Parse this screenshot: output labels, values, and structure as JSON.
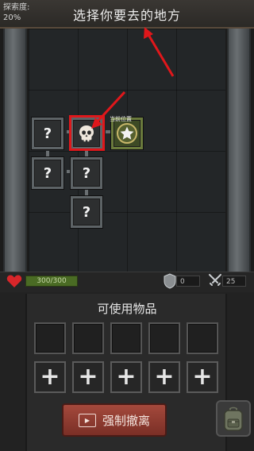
{
  "header": {
    "explore_label": "探索度:",
    "explore_value": "20%",
    "title": "选择你要去的地方"
  },
  "map": {
    "current_position_label": "当前位置",
    "unknown_symbol": "?",
    "current_symbol": "★",
    "danger_icon": "skull-icon"
  },
  "status": {
    "hp": "300/300",
    "armor": "0",
    "attack": "25"
  },
  "items": {
    "title": "可使用物品",
    "add_symbol": "+"
  },
  "actions": {
    "retreat_label": "强制撤离"
  },
  "colors": {
    "highlight": "#e0171b",
    "hp_bar": "#4a6b24",
    "retreat_button": "#a4493c"
  }
}
